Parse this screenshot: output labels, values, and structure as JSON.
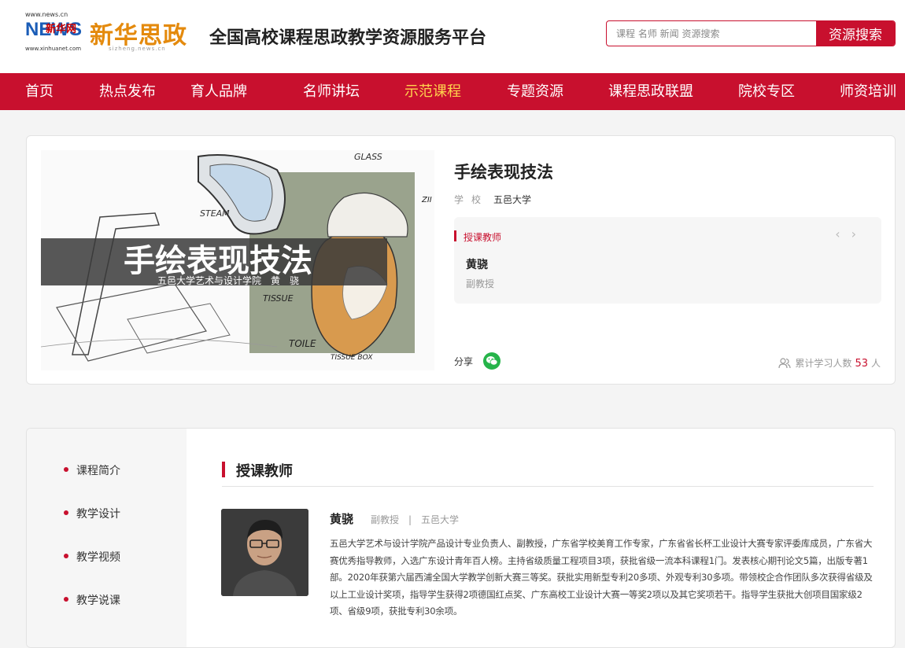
{
  "header": {
    "logo": {
      "url_top": "www.news.cn",
      "news_mark": "NEWS",
      "news_cn": "新华网",
      "url_bottom": "www.xinhuanet.com",
      "brand": "新华思政",
      "brand_sub": "sizheng.news.cn"
    },
    "site_title": "全国高校课程思政教学资源服务平台",
    "search": {
      "placeholder": "课程 名师 新闻 资源搜索",
      "button_label": "资源搜索"
    }
  },
  "nav": {
    "items": [
      {
        "label": "首页"
      },
      {
        "label": "热点发布"
      },
      {
        "label": "育人品牌"
      },
      {
        "label": "名师讲坛"
      },
      {
        "label": "示范课程"
      },
      {
        "label": "专题资源"
      },
      {
        "label": "课程思政联盟"
      },
      {
        "label": "院校专区"
      },
      {
        "label": "师资培训"
      }
    ],
    "active_index": 4
  },
  "course": {
    "cover": {
      "banner_title": "手绘表现技法",
      "banner_subtitle": "五邑大学艺术与设计学院　黄　骁",
      "sketch_labels": [
        "GLASS",
        "STEAM",
        "TISSUE",
        "TOILE",
        "TISSUE BOX",
        "ZII"
      ]
    },
    "title": "手绘表现技法",
    "school_label": "学校",
    "school": "五邑大学",
    "teacher_box": {
      "heading": "授课教师",
      "prev": "‹",
      "next": "›",
      "name": "黄骁",
      "title": "副教授"
    },
    "share_label": "分享",
    "learners": {
      "label": "累计学习人数",
      "count": "53",
      "unit": "人"
    }
  },
  "sidebar": {
    "items": [
      {
        "label": "课程简介"
      },
      {
        "label": "教学设计"
      },
      {
        "label": "教学视频"
      },
      {
        "label": "教学说课"
      }
    ]
  },
  "teacher_section": {
    "title": "授课教师",
    "name": "黄骁",
    "meta": "副教授　|　五邑大学",
    "bio": "五邑大学艺术与设计学院产品设计专业负责人、副教授，广东省学校美育工作专家，广东省省长杯工业设计大赛专家评委库成员，广东省大赛优秀指导教师，入选广东设计青年百人榜。主持省级质量工程项目3项，获批省级一流本科课程1门。发表核心期刊论文5篇，出版专著1部。2020年获第六届西浦全国大学教学创新大赛三等奖。获批实用新型专利20多项、外观专利30多项。带领校企合作团队多次获得省级及以上工业设计奖项，指导学生获得2项德国红点奖、广东高校工业设计大赛一等奖2项以及其它奖项若干。指导学生获批大创项目国家级2项、省级9项，获批专利30余项。"
  }
}
